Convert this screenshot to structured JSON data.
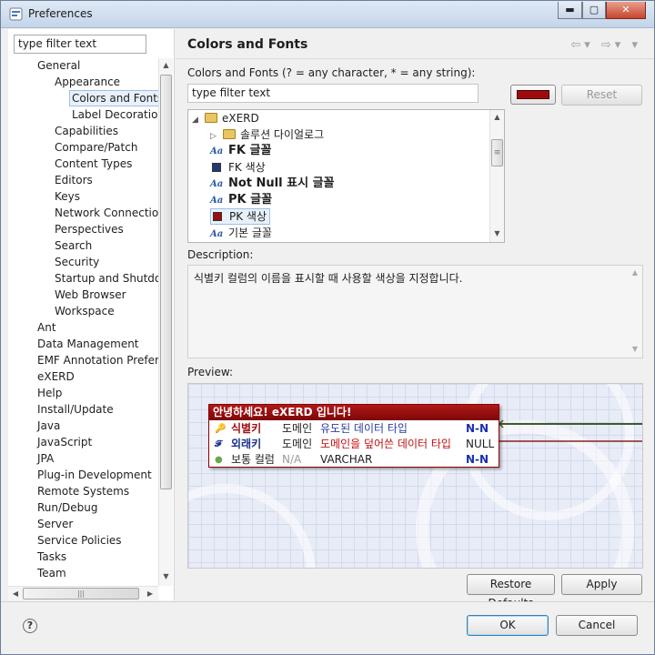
{
  "window": {
    "title": "Preferences",
    "minimize": "▬",
    "maximize": "▢",
    "close": "✕"
  },
  "left": {
    "filter_value": "type filter text",
    "tree": [
      {
        "label": "General",
        "level": 1
      },
      {
        "label": "Appearance",
        "level": 2
      },
      {
        "label": "Colors and Fonts",
        "level": 3,
        "selected": true
      },
      {
        "label": "Label Decorations",
        "level": 3
      },
      {
        "label": "Capabilities",
        "level": 2
      },
      {
        "label": "Compare/Patch",
        "level": 2
      },
      {
        "label": "Content Types",
        "level": 2
      },
      {
        "label": "Editors",
        "level": 2
      },
      {
        "label": "Keys",
        "level": 2
      },
      {
        "label": "Network Connections",
        "level": 2
      },
      {
        "label": "Perspectives",
        "level": 2
      },
      {
        "label": "Search",
        "level": 2
      },
      {
        "label": "Security",
        "level": 2
      },
      {
        "label": "Startup and Shutdown",
        "level": 2
      },
      {
        "label": "Web Browser",
        "level": 2
      },
      {
        "label": "Workspace",
        "level": 2
      },
      {
        "label": "Ant",
        "level": 1
      },
      {
        "label": "Data Management",
        "level": 1
      },
      {
        "label": "EMF Annotation Preferences",
        "level": 1
      },
      {
        "label": "eXERD",
        "level": 1
      },
      {
        "label": "Help",
        "level": 1
      },
      {
        "label": "Install/Update",
        "level": 1
      },
      {
        "label": "Java",
        "level": 1
      },
      {
        "label": "JavaScript",
        "level": 1
      },
      {
        "label": "JPA",
        "level": 1
      },
      {
        "label": "Plug-in Development",
        "level": 1
      },
      {
        "label": "Remote Systems",
        "level": 1
      },
      {
        "label": "Run/Debug",
        "level": 1
      },
      {
        "label": "Server",
        "level": 1
      },
      {
        "label": "Service Policies",
        "level": 1
      },
      {
        "label": "Tasks",
        "level": 1
      },
      {
        "label": "Team",
        "level": 1
      }
    ]
  },
  "page": {
    "title": "Colors and Fonts",
    "nav_icons": "⇦▾ ⇨▾ ▾",
    "filter_label": "Colors and Fonts (? = any character, * = any string):",
    "filter_value": "type filter text",
    "color_swatch": "#9e0b0f",
    "reset_label": "Reset",
    "tree": [
      {
        "label": "eXERD",
        "kind": "folder",
        "level": 0,
        "expander": "◢"
      },
      {
        "label": "솔루션 다이얼로그",
        "kind": "folder",
        "level": 1,
        "expander": "▷"
      },
      {
        "label": "FK 글꼴",
        "kind": "font",
        "level": 1,
        "bold": true
      },
      {
        "label": "FK 색상",
        "kind": "color",
        "level": 1,
        "color": "#1f3a6e"
      },
      {
        "label": "Not Null 표시 글꼴",
        "kind": "font",
        "level": 1,
        "bold": true
      },
      {
        "label": "PK 글꼴",
        "kind": "font",
        "level": 1,
        "bold": true
      },
      {
        "label": "PK 색상",
        "kind": "color",
        "level": 1,
        "color": "#9e0b0f",
        "selected": true
      },
      {
        "label": "기본 글꼴",
        "kind": "font",
        "level": 1
      }
    ],
    "font_icon": "Aa",
    "description_label": "Description:",
    "description_text": "식별키 컬럼의 이름을 표시할 때 사용할 색상을 지정합니다.",
    "preview_label": "Preview:",
    "entity": {
      "title": "안녕하세요! eXERD 입니다!",
      "rows": [
        {
          "icon": "🔑",
          "name": "식별키",
          "domain": "도메인",
          "type": "유도된 데이터 타입",
          "null": "N-N",
          "kind": "pk"
        },
        {
          "icon": "𝓕",
          "name": "외래키",
          "domain": "도메인",
          "type": "도메인을 덮어쓴 데이터 타입",
          "null": "NULL",
          "kind": "fk"
        },
        {
          "icon": "●",
          "name": "보통 컬럼",
          "domain": "N/A",
          "type": "VARCHAR",
          "null": "N-N",
          "kind": "normal"
        }
      ]
    },
    "restore_label": "Restore Defaults",
    "apply_label": "Apply"
  },
  "footer": {
    "help": "?",
    "ok_label": "OK",
    "cancel_label": "Cancel"
  },
  "scroll": {
    "up": "▲",
    "down": "▼",
    "left": "◀",
    "right": "▶",
    "grip": "≡",
    "hgrip": "|||"
  }
}
